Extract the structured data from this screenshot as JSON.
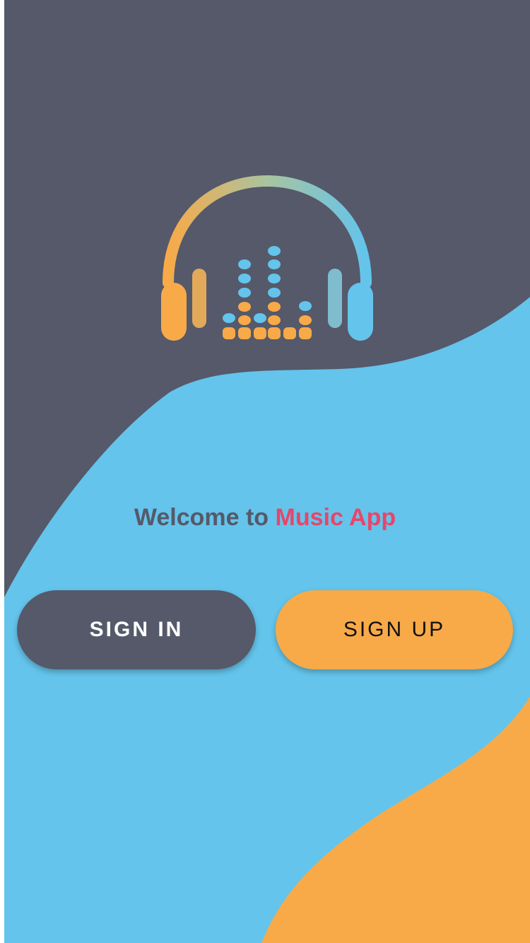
{
  "app": {
    "welcome_prefix": "Welcome to",
    "welcome_app_name": "Music App"
  },
  "buttons": {
    "sign_in_label": "SIGN IN",
    "sign_up_label": "SIGN UP"
  },
  "logo": {
    "icon": "headphones-equalizer-icon"
  },
  "colors": {
    "dark": "#55596a",
    "blue": "#64c4eb",
    "orange": "#f8aa48",
    "accent_pink": "#e8456a"
  }
}
